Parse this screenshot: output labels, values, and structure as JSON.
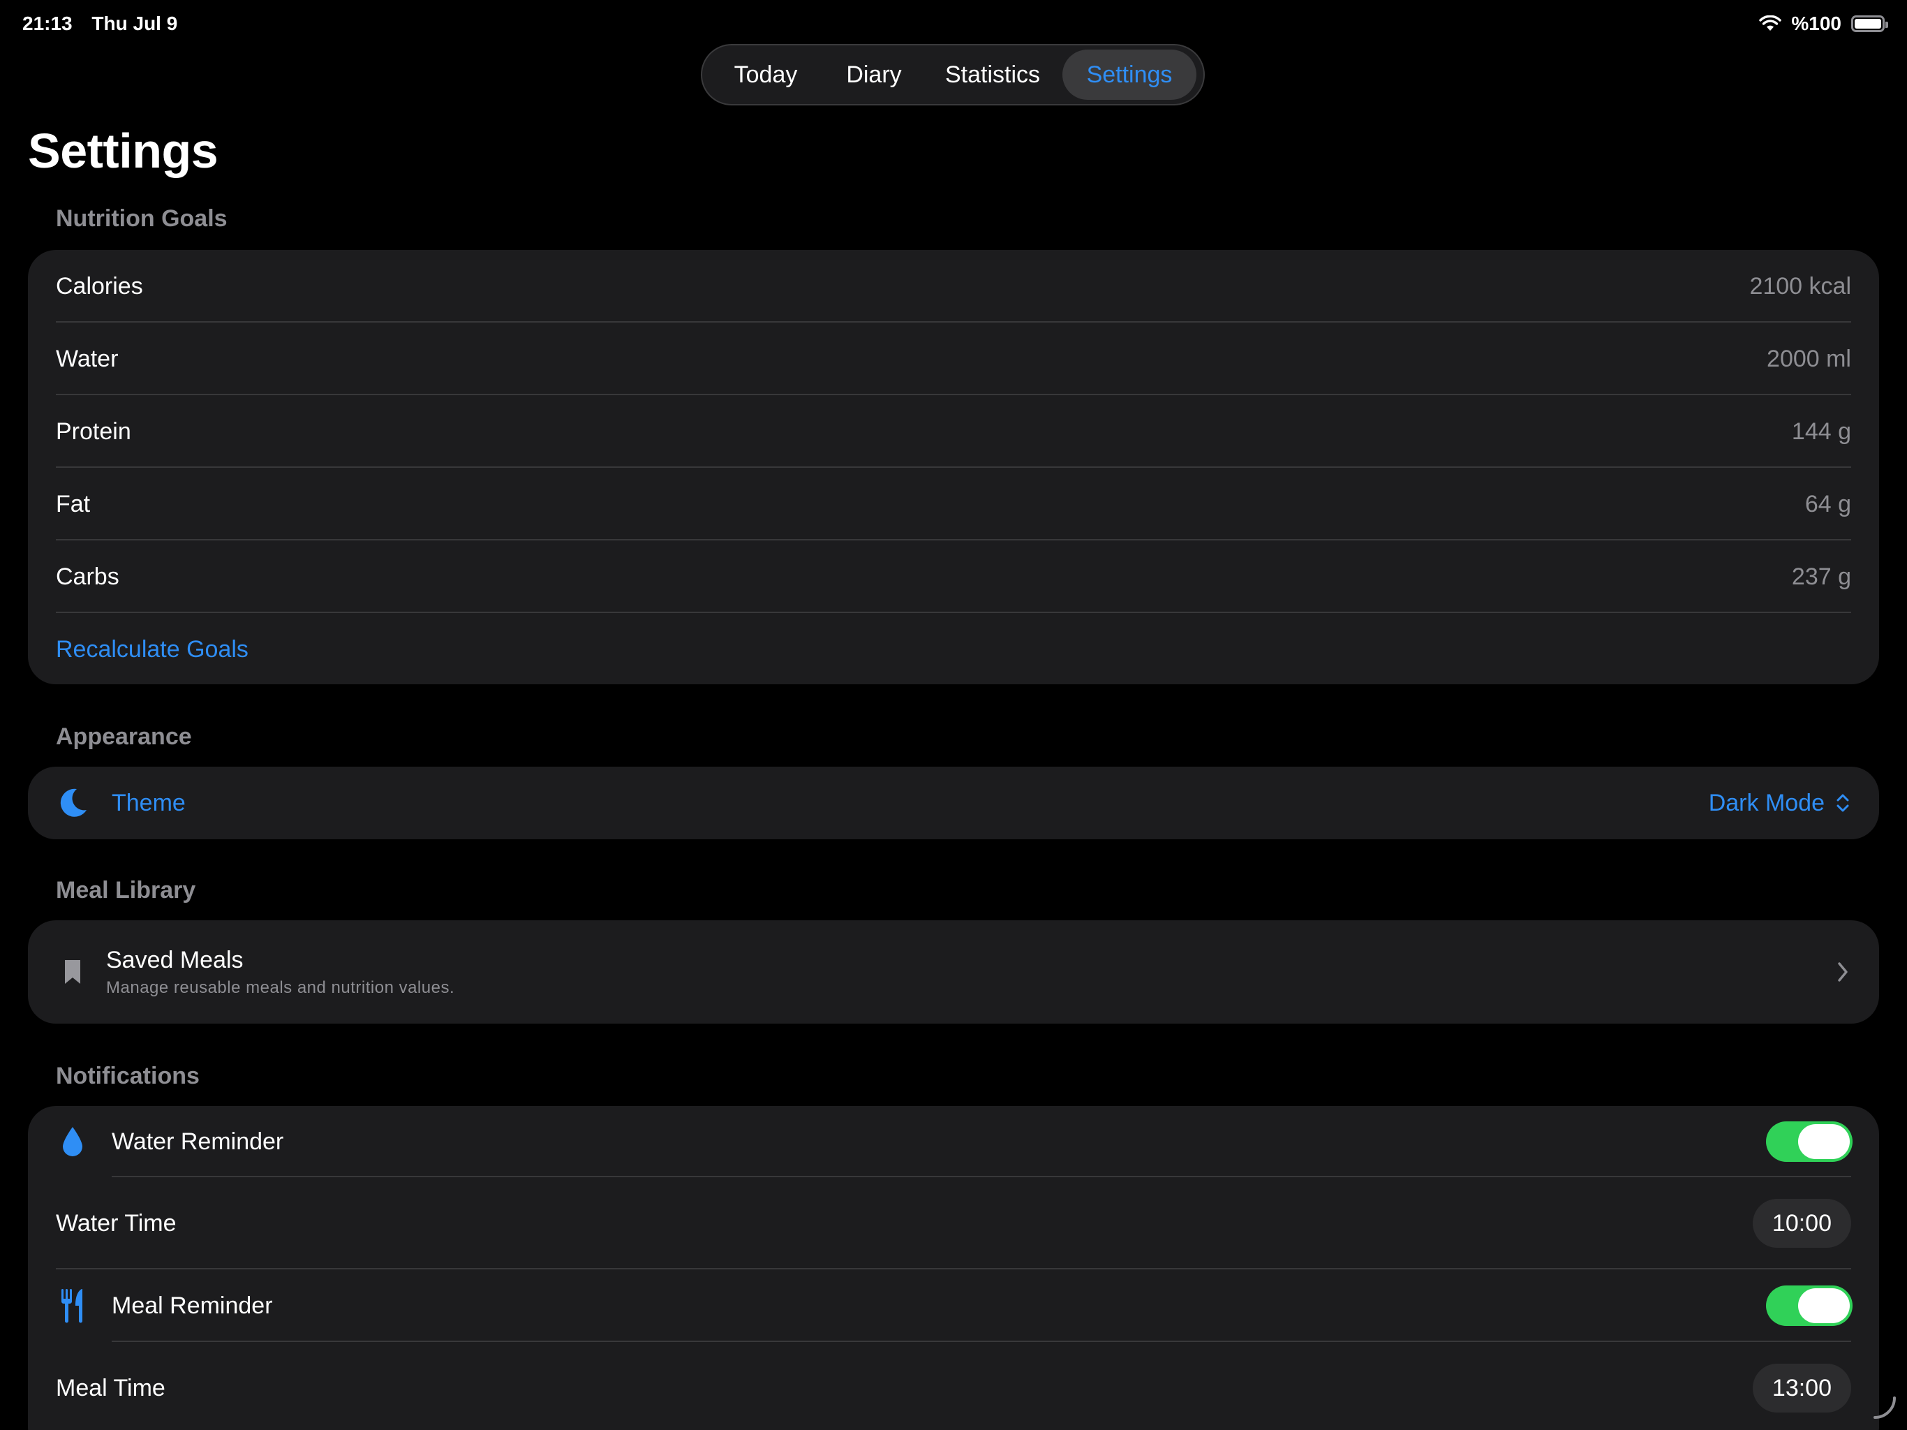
{
  "status_bar": {
    "time": "21:13",
    "date": "Thu Jul 9",
    "battery": "%100",
    "wifi_icon": "wifi-icon",
    "battery_icon": "battery-icon"
  },
  "tabs": [
    {
      "label": "Today",
      "active": false
    },
    {
      "label": "Diary",
      "active": false
    },
    {
      "label": "Statistics",
      "active": false
    },
    {
      "label": "Settings",
      "active": true
    }
  ],
  "page": {
    "title": "Settings"
  },
  "nutrition_goals": {
    "header": "Nutrition Goals",
    "rows": [
      {
        "label": "Calories",
        "value": "2100 kcal"
      },
      {
        "label": "Water",
        "value": "2000 ml"
      },
      {
        "label": "Protein",
        "value": "144 g"
      },
      {
        "label": "Fat",
        "value": "64 g"
      },
      {
        "label": "Carbs",
        "value": "237 g"
      }
    ],
    "action": "Recalculate Goals"
  },
  "appearance": {
    "header": "Appearance",
    "theme_label": "Theme",
    "theme_value": "Dark Mode",
    "icon": "moon-icon"
  },
  "meal_library": {
    "header": "Meal Library",
    "title": "Saved Meals",
    "subtitle": "Manage reusable meals and nutrition values.",
    "icon": "bookmark-icon"
  },
  "notifications": {
    "header": "Notifications",
    "water_reminder": {
      "label": "Water Reminder",
      "enabled": true,
      "icon": "water-drop-icon"
    },
    "water_time": {
      "label": "Water Time",
      "value": "10:00"
    },
    "meal_reminder": {
      "label": "Meal Reminder",
      "enabled": true,
      "icon": "fork-knife-icon"
    },
    "meal_time": {
      "label": "Meal Time",
      "value": "13:00"
    }
  },
  "colors": {
    "accent": "#2f8ef5",
    "toggle_on": "#30d158",
    "card": "#1c1c1e",
    "background": "#000000"
  }
}
